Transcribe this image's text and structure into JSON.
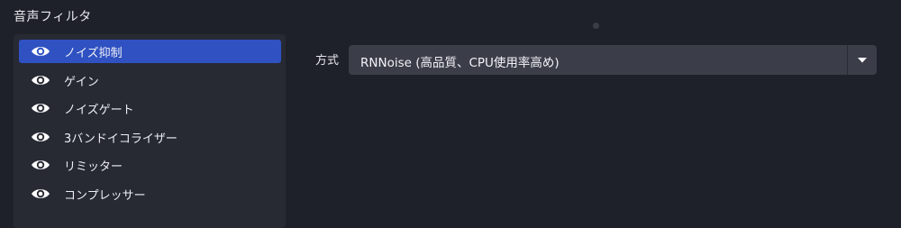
{
  "section_title": "音声フィルタ",
  "filters": [
    {
      "label": "ノイズ抑制",
      "icon": "eye-icon",
      "selected": true
    },
    {
      "label": "ゲイン",
      "icon": "eye-icon",
      "selected": false
    },
    {
      "label": "ノイズゲート",
      "icon": "eye-icon",
      "selected": false
    },
    {
      "label": "3バンドイコライザー",
      "icon": "eye-icon",
      "selected": false
    },
    {
      "label": "リミッター",
      "icon": "eye-icon",
      "selected": false
    },
    {
      "label": "コンプレッサー",
      "icon": "eye-icon",
      "selected": false
    }
  ],
  "properties": {
    "method_label": "方式",
    "method_value": "RNNoise (高品質、CPU使用率高め)",
    "dropdown_icon": "caret-down-icon"
  },
  "colors": {
    "background": "#1f212a",
    "panel": "#272933",
    "selected": "#2f51c2",
    "select_bg": "#3b3d49"
  }
}
